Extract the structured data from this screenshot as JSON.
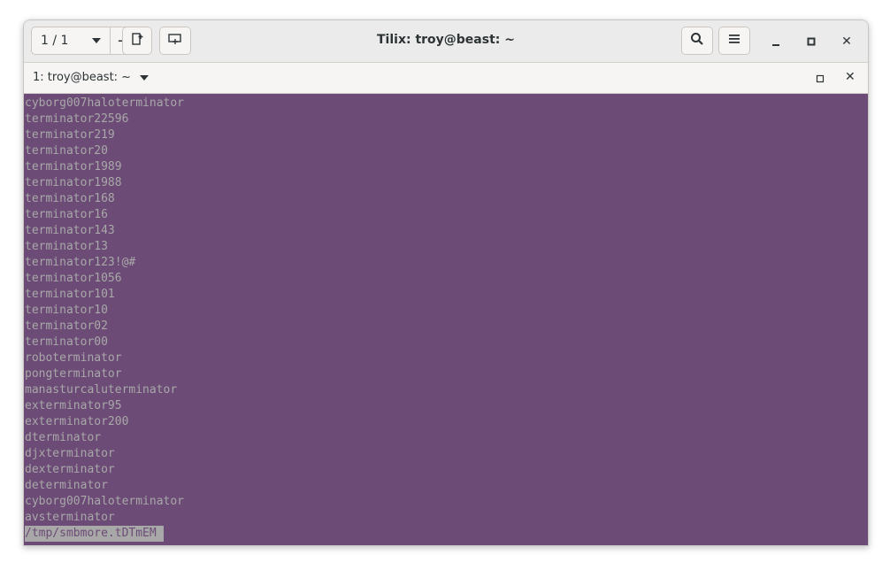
{
  "window": {
    "title": "Tilix: troy@beast: ~",
    "session_indicator": "1 / 1",
    "add_label": "+",
    "close_symbol": "✕"
  },
  "tab": {
    "title": "1: troy@beast: ~",
    "close_symbol": "✕"
  },
  "terminal": {
    "background": "#6c4b76",
    "foreground": "#a8a8a8",
    "lines": [
      "cyborg007haloterminator",
      "terminator22596",
      "terminator219",
      "terminator20",
      "terminator1989",
      "terminator1988",
      "terminator168",
      "terminator16",
      "terminator143",
      "terminator13",
      "terminator123!@#",
      "terminator1056",
      "terminator101",
      "terminator10",
      "terminator02",
      "terminator00",
      "roboterminator",
      "pongterminator",
      "manasturcaluterminator",
      "exterminator95",
      "exterminator200",
      "dterminator",
      "djxterminator",
      "dexterminator",
      "determinator",
      "cyborg007haloterminator",
      "avsterminator"
    ],
    "pager_prompt": "/tmp/smbmore.tDTmEM"
  },
  "icons": {
    "new_session": "new-session-icon",
    "sync_input": "sync-input-icon",
    "search": "search-icon",
    "menu": "hamburger-menu-icon",
    "minimize": "minimize-icon",
    "maximize": "maximize-icon",
    "close": "close-icon"
  }
}
